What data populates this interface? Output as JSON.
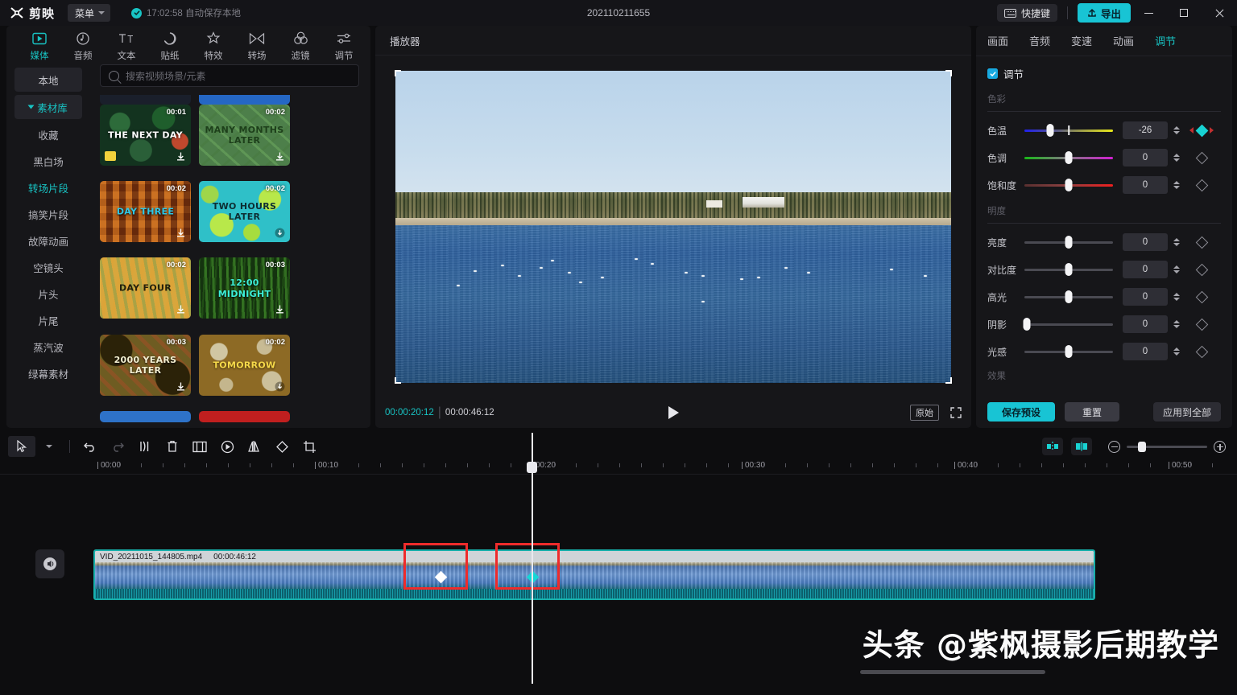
{
  "titlebar": {
    "brand": "剪映",
    "menu_label": "菜单",
    "autosave_text": "17:02:58 自动保存本地",
    "document_title": "202110211655",
    "hotkey_label": "快捷键",
    "export_label": "导出",
    "accent": "#18c4d4"
  },
  "nav_tabs": [
    {
      "label": "媒体",
      "icon": "media-icon",
      "active": true
    },
    {
      "label": "音频",
      "icon": "audio-icon",
      "active": false
    },
    {
      "label": "文本",
      "icon": "text-icon",
      "active": false
    },
    {
      "label": "贴纸",
      "icon": "sticker-icon",
      "active": false
    },
    {
      "label": "特效",
      "icon": "effects-icon",
      "active": false
    },
    {
      "label": "转场",
      "icon": "transition-icon",
      "active": false
    },
    {
      "label": "滤镜",
      "icon": "filter-icon",
      "active": false
    },
    {
      "label": "调节",
      "icon": "adjust-icon",
      "active": false
    }
  ],
  "library": {
    "local_label": "本地",
    "stock_label": "素材库",
    "categories": [
      {
        "label": "收藏",
        "selected": false
      },
      {
        "label": "黑白场",
        "selected": false
      },
      {
        "label": "转场片段",
        "selected": true
      },
      {
        "label": "搞笑片段",
        "selected": false
      },
      {
        "label": "故障动画",
        "selected": false
      },
      {
        "label": "空镜头",
        "selected": false
      },
      {
        "label": "片头",
        "selected": false
      },
      {
        "label": "片尾",
        "selected": false
      },
      {
        "label": "蒸汽波",
        "selected": false
      },
      {
        "label": "绿幕素材",
        "selected": false
      }
    ],
    "search_placeholder": "搜索视频场景/元素",
    "thumbnails": [
      {
        "caption": "THE NEXT DAY",
        "duration": "00:01",
        "bg": "#13331f",
        "accent": "#2d6b3a",
        "text_color": "#ffffff"
      },
      {
        "caption": "MANY MONTHS LATER",
        "duration": "00:02",
        "bg": "#4d7f4a",
        "accent": "#69a35f",
        "text_color": "#1d3f1a"
      },
      {
        "caption": "DAY THREE",
        "duration": "00:02",
        "bg": "#8a3a10",
        "accent": "#c3631c",
        "text_color": "#2ec8e8"
      },
      {
        "caption": "TWO HOURS LATER",
        "duration": "00:02",
        "bg": "#2fc0c8",
        "accent": "#b8e84a",
        "text_color": "#0d2e33"
      },
      {
        "caption": "DAY FOUR",
        "duration": "00:02",
        "bg": "#d9a63c",
        "accent": "#7ea85c",
        "text_color": "#23200c"
      },
      {
        "caption": "12:00 MIDNIGHT",
        "duration": "00:03",
        "bg": "#14330f",
        "accent": "#3d7a28",
        "text_color": "#3cf0d8"
      },
      {
        "caption": "2000 YEARS LATER",
        "duration": "00:03",
        "bg": "#6e5c22",
        "accent": "#3d2e12",
        "text_color": "#f4f0d2"
      },
      {
        "caption": "TOMORROW",
        "duration": "00:02",
        "bg": "#8d6a25",
        "accent": "#c9bd8a",
        "text_color": "#f6d94a"
      }
    ]
  },
  "player": {
    "header": "播放器",
    "current_time": "00:00:20:12",
    "total_time": "00:00:46:12",
    "original_label": "原始",
    "icons": {
      "play": "play-icon",
      "fullscreen": "fullscreen-icon"
    }
  },
  "inspector": {
    "tabs": [
      {
        "label": "画面",
        "active": false
      },
      {
        "label": "音频",
        "active": false
      },
      {
        "label": "变速",
        "active": false
      },
      {
        "label": "动画",
        "active": false
      },
      {
        "label": "调节",
        "active": true
      }
    ],
    "enable_label": "调节",
    "enabled": true,
    "sections": [
      {
        "title": "色彩",
        "controls": [
          {
            "name": "色温",
            "value": "-26",
            "pos": 29,
            "track": "tk-temp",
            "midtick": 50,
            "keyframe_on": true
          },
          {
            "name": "色调",
            "value": "0",
            "pos": 50,
            "track": "tk-tint",
            "keyframe_on": false
          },
          {
            "name": "饱和度",
            "value": "0",
            "pos": 50,
            "track": "tk-sat",
            "keyframe_on": false
          }
        ]
      },
      {
        "title": "明度",
        "controls": [
          {
            "name": "亮度",
            "value": "0",
            "pos": 50,
            "track": "tk-gray",
            "keyframe_on": false
          },
          {
            "name": "对比度",
            "value": "0",
            "pos": 50,
            "track": "tk-gray",
            "keyframe_on": false
          },
          {
            "name": "高光",
            "value": "0",
            "pos": 50,
            "track": "tk-gray",
            "keyframe_on": false
          },
          {
            "name": "阴影",
            "value": "0",
            "pos": 2,
            "track": "tk-gray",
            "keyframe_on": false
          },
          {
            "name": "光感",
            "value": "0",
            "pos": 50,
            "track": "tk-gray",
            "keyframe_on": false
          }
        ]
      }
    ],
    "effects_label": "效果",
    "save_preset_label": "保存预设",
    "reset_label": "重置",
    "apply_all_label": "应用到全部"
  },
  "timeline": {
    "tools": [
      {
        "name": "select-tool",
        "icon": "cursor-icon"
      },
      {
        "name": "tool-dropdown",
        "icon": "chevron-down-icon"
      },
      {
        "name": "undo",
        "icon": "undo-icon"
      },
      {
        "name": "redo",
        "icon": "redo-icon"
      },
      {
        "name": "split",
        "icon": "split-icon"
      },
      {
        "name": "delete",
        "icon": "trash-icon"
      },
      {
        "name": "freeze",
        "icon": "freeze-icon"
      },
      {
        "name": "reverse",
        "icon": "reverse-icon"
      },
      {
        "name": "mirror",
        "icon": "mirror-icon"
      },
      {
        "name": "rotate",
        "icon": "rotate-icon"
      },
      {
        "name": "crop",
        "icon": "crop-icon"
      }
    ],
    "right_tools": [
      {
        "name": "auto-snap",
        "icon": "snap-icon"
      },
      {
        "name": "adsorb",
        "icon": "magnet-icon"
      }
    ],
    "zoom_out_icon": "zoom-out-icon",
    "zoom_in_icon": "zoom-in-icon",
    "ruler_labels": [
      "00:00",
      "00:10",
      "00:20",
      "00:30",
      "00:40",
      "00:50"
    ],
    "clip": {
      "filename": "VID_20211015_144805.mp4",
      "duration": "00:00:46:12",
      "keyframes": [
        {
          "type": "white",
          "highlighted": true
        },
        {
          "type": "cyan",
          "highlighted": true
        }
      ]
    },
    "mute_icon": "speaker-icon"
  },
  "watermark": {
    "text": "头条 @紫枫摄影后期教学"
  }
}
